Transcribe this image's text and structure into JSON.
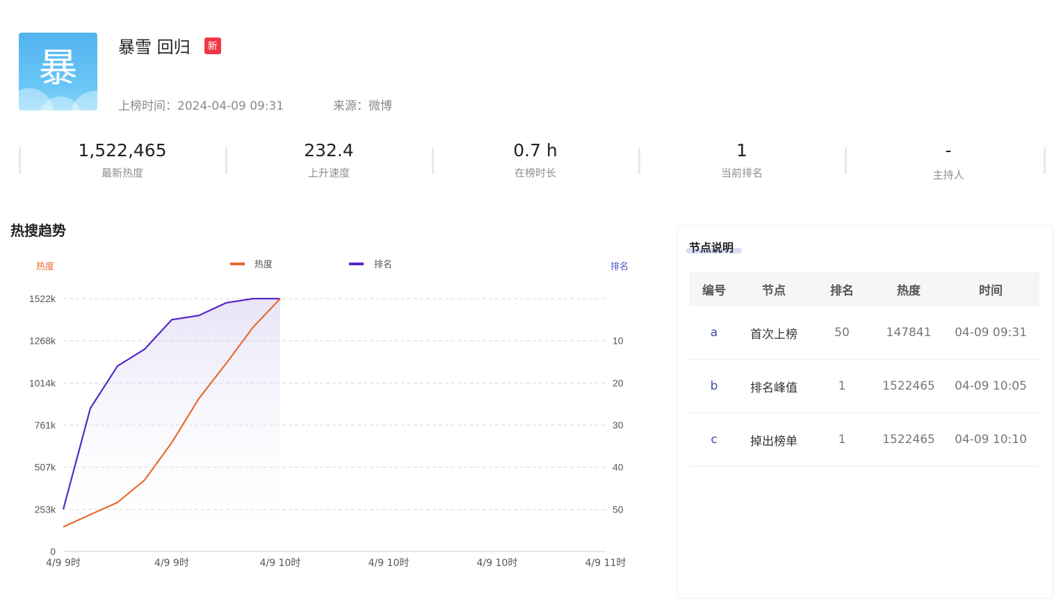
{
  "topic": {
    "logo_char": "暴",
    "title": "暴雪 回归",
    "badge": "新",
    "listed_time": "上榜时间：2024-04-09 09:31",
    "source": "来源：微博"
  },
  "stats": [
    {
      "value": "1,522,465",
      "label": "最新热度"
    },
    {
      "value": "232.4",
      "label": "上升速度"
    },
    {
      "value": "0.7 h",
      "label": "在榜时长"
    },
    {
      "value": "1",
      "label": "当前排名"
    },
    {
      "value": "-",
      "label": "主持人"
    }
  ],
  "trend_section": {
    "title": "热搜趋势"
  },
  "chart_data": {
    "type": "line",
    "left_axis_name": "热度",
    "right_axis_name": "排名",
    "legend": [
      "热度",
      "排名"
    ],
    "x_labels": [
      "4/9 9时",
      "4/9 9时",
      "4/9 10时",
      "4/9 10时",
      "4/9 10时",
      "4/9 11时"
    ],
    "x_range": [
      0,
      20
    ],
    "y_left_ticks": [
      {
        "value": 0,
        "label": "0"
      },
      {
        "value": 253,
        "label": "253k"
      },
      {
        "value": 507,
        "label": "507k"
      },
      {
        "value": 761,
        "label": "761k"
      },
      {
        "value": 1014,
        "label": "1014k"
      },
      {
        "value": 1268,
        "label": "1268k"
      },
      {
        "value": 1522,
        "label": "1522k"
      }
    ],
    "y_right_ticks": [
      {
        "value": 10,
        "label": "10"
      },
      {
        "value": 20,
        "label": "20"
      },
      {
        "value": 30,
        "label": "30"
      },
      {
        "value": 40,
        "label": "40"
      },
      {
        "value": 50,
        "label": "50"
      }
    ],
    "y_left_range": [
      0,
      1522
    ],
    "y_right_range": [
      0,
      60
    ],
    "grid": true,
    "legend_position": "top-center",
    "series": [
      {
        "name": "热度",
        "axis": "left",
        "color": "#e8672c",
        "x": [
          0,
          1,
          2,
          3,
          4,
          5,
          6,
          7,
          8
        ],
        "values": [
          148,
          222,
          295,
          430,
          655,
          920,
          1130,
          1350,
          1522
        ]
      },
      {
        "name": "排名",
        "axis": "right",
        "color": "#5426c8",
        "x": [
          0,
          1,
          2,
          3,
          4,
          5,
          6,
          7,
          8
        ],
        "values": [
          50,
          26,
          16,
          12,
          5,
          4,
          1,
          0,
          0
        ]
      }
    ]
  },
  "nodes_panel": {
    "title": "节点说明",
    "headers": [
      "编号",
      "节点",
      "排名",
      "热度",
      "时间"
    ],
    "rows": [
      [
        "a",
        "首次上榜",
        "50",
        "147841",
        "04-09 09:31"
      ],
      [
        "b",
        "排名峰值",
        "1",
        "1522465",
        "04-09 10:05"
      ],
      [
        "c",
        "掉出榜单",
        "1",
        "1522465",
        "04-09 10:10"
      ]
    ]
  }
}
